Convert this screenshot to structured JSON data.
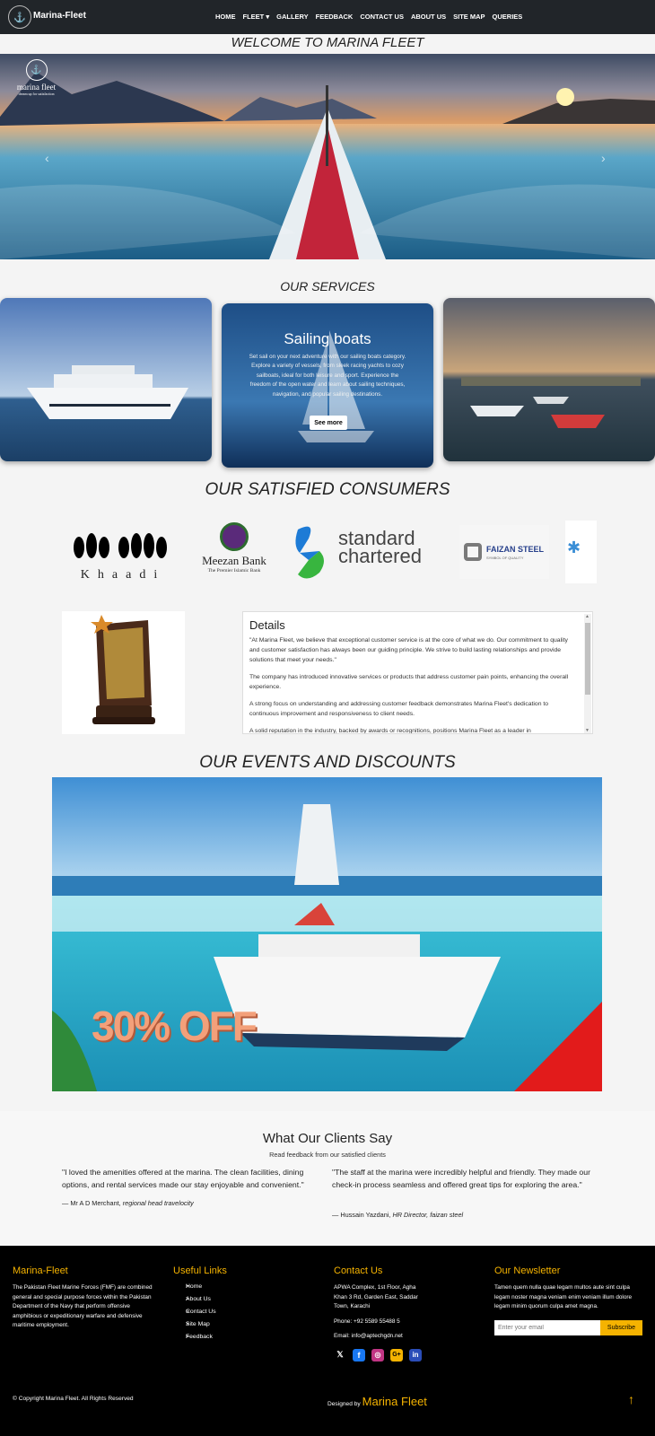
{
  "nav": {
    "brand": "Marina-Fleet",
    "links": [
      "HOME",
      "FLEET ▾",
      "GALLERY",
      "FEEDBACK",
      "CONTACT US",
      "ABOUT US",
      "SITE MAP",
      "QUERIES"
    ]
  },
  "hero": {
    "welcome": "WELCOME TO MARINA FLEET",
    "logo_text": "marina fleet",
    "logo_tagline": "dream up for satisfaction"
  },
  "services": {
    "title": "OUR SERVICES",
    "card_title": "Sailing boats",
    "card_text": "Set sail on your next adventure with our sailing boats category. Explore a variety of vessels, from sleek racing yachts to cozy sailboats, ideal for both leisure and sport. Experience the freedom of the open water and learn about sailing techniques, navigation, and popular sailing destinations.",
    "card_button": "See more"
  },
  "consumers": {
    "title": "OUR SATISFIED CONSUMERS",
    "logos": [
      "Khaadi",
      "Meezan Bank",
      "The Premier Islamic Bank",
      "standard chartered",
      "FAIZAN STEEL",
      "SYMBOL OF QUALITY"
    ]
  },
  "details": {
    "heading": "Details",
    "paragraphs": [
      "\"At Marina Fleet, we believe that exceptional customer service is at the core of what we do. Our commitment to quality and customer satisfaction has always been our guiding principle. We strive to build lasting relationships and provide solutions that meet your needs.\"",
      "The company has introduced innovative services or products that address customer pain points, enhancing the overall experience.",
      "A strong focus on understanding and addressing customer feedback demonstrates Marina Fleet's dedication to continuous improvement and responsiveness to client needs.",
      "A solid reputation in the industry, backed by awards or recognitions, positions Marina Fleet as a leader in"
    ]
  },
  "events": {
    "title": "OUR EVENTS AND DISCOUNTS",
    "discount": "30% OFF"
  },
  "clients": {
    "title": "What Our Clients Say",
    "subtitle": "Read feedback from our satisfied clients",
    "quote1": "\"I loved the amenities offered at the marina. The clean facilities, dining options, and rental services made our stay enjoyable and convenient.\"",
    "author1_name": "— Mr A D Merchant,",
    "author1_role": "regional head travelocity",
    "quote2": "\"The staff at the marina were incredibly helpful and friendly. They made our check-in process seamless and offered great tips for exploring the area.\"",
    "author2_name": "— Hussain Yazdani,",
    "author2_role": "HR Director, faizan steel"
  },
  "footer": {
    "about_title": "Marina-Fleet",
    "about_text": "The Pakistan Fleet Marine Forces (FMF) are combined general and special purpose forces within the Pakistan Department of the Navy that perform offensive amphibious or expeditionary warfare and defensive maritime employment.",
    "links_title": "Useful Links",
    "links": [
      "Home",
      "About Us",
      "Contact Us",
      "Site Map",
      "Feedback"
    ],
    "contact_title": "Contact Us",
    "address": "APWA Complex, 1st Floor, Agha Khan 3 Rd, Garden East, Saddar Town, Karachi",
    "phone": "Phone: +92 5589 55488 5",
    "email": "Email: info@aptechgdn.net",
    "newsletter_title": "Our Newsletter",
    "newsletter_text": "Tamen quem nulla quae legam multos aute sint culpa legam noster magna veniam enim veniam illum dolore legam minim quorum culpa amet magna.",
    "email_placeholder": "Enter your email",
    "subscribe": "Subscribe",
    "copyright": "© Copyright Marina Fleet. All Rights Reserved",
    "designed_by": "Designed by",
    "designer": "Marina Fleet"
  },
  "colors": {
    "accent": "#f5b301",
    "navbar": "#212529",
    "footer": "#000000"
  }
}
